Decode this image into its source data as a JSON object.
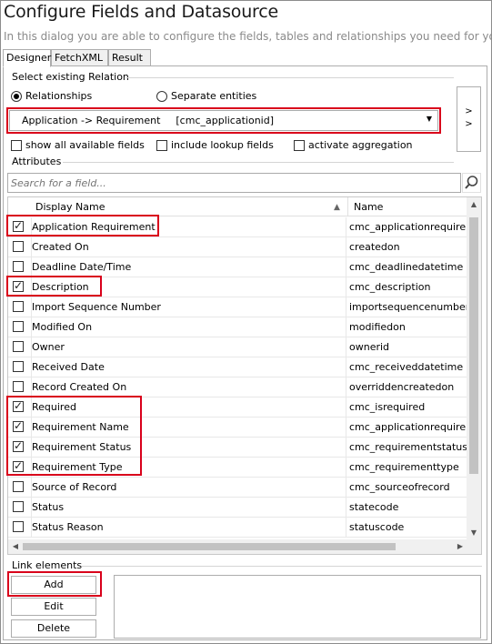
{
  "window": {
    "title": "Configure Fields and Datasource",
    "subtitle": "In this dialog you are able to configure the fields, tables and relationships you need for your"
  },
  "tabs": [
    {
      "label": "Designer",
      "active": true
    },
    {
      "label": "FetchXML",
      "active": false
    },
    {
      "label": "Result",
      "active": false
    }
  ],
  "relation": {
    "group_label": "Select existing Relation",
    "option_relationships": "Relationships",
    "option_separate": "Separate entities",
    "selected_option": "Relationships",
    "combo_value": "Application -> Requirement",
    "combo_key": "[cmc_applicationid]",
    "arrow_button_label": "> >",
    "show_all_label": "show all available fields",
    "include_lookup_label": "include lookup fields",
    "activate_aggregation_label": "activate aggregation"
  },
  "attributes": {
    "group_label": "Attributes",
    "search_placeholder": "Search for a field...",
    "col_display": "Display Name",
    "col_name": "Name",
    "rows": [
      {
        "display": "Application Requirement",
        "name": "cmc_applicationrequirem",
        "checked": true
      },
      {
        "display": "Created On",
        "name": "createdon",
        "checked": false
      },
      {
        "display": "Deadline Date/Time",
        "name": "cmc_deadlinedatetime",
        "checked": false
      },
      {
        "display": "Description",
        "name": "cmc_description",
        "checked": true
      },
      {
        "display": "Import Sequence Number",
        "name": "importsequencenumber",
        "checked": false
      },
      {
        "display": "Modified On",
        "name": "modifiedon",
        "checked": false
      },
      {
        "display": "Owner",
        "name": "ownerid",
        "checked": false
      },
      {
        "display": "Received Date",
        "name": "cmc_receiveddatetime",
        "checked": false
      },
      {
        "display": "Record Created On",
        "name": "overriddencreatedon",
        "checked": false
      },
      {
        "display": "Required",
        "name": "cmc_isrequired",
        "checked": true
      },
      {
        "display": "Requirement Name",
        "name": "cmc_applicationrequirem",
        "checked": true
      },
      {
        "display": "Requirement Status",
        "name": "cmc_requirementstatus",
        "checked": true
      },
      {
        "display": "Requirement Type",
        "name": "cmc_requirementtype",
        "checked": true
      },
      {
        "display": "Source of Record",
        "name": "cmc_sourceofrecord",
        "checked": false
      },
      {
        "display": "Status",
        "name": "statecode",
        "checked": false
      },
      {
        "display": "Status Reason",
        "name": "statuscode",
        "checked": false
      }
    ]
  },
  "links": {
    "group_label": "Link elements",
    "add_label": "Add",
    "edit_label": "Edit",
    "delete_label": "Delete"
  },
  "colors": {
    "highlight": "#d9001b",
    "border": "#adadad",
    "subtitle": "#8a8a8a"
  },
  "icons": [
    "search-icon",
    "dropdown-arrow-icon",
    "sort-arrow-icon"
  ]
}
